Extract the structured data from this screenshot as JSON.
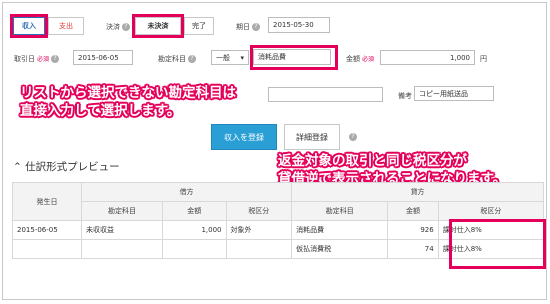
{
  "tabs": {
    "income": "収入",
    "expense": "支出"
  },
  "settlement": {
    "label": "決済",
    "unsettled": "未決済",
    "completed": "完了"
  },
  "due_date": {
    "label": "期日",
    "value": "2015-05-30"
  },
  "transaction_date": {
    "label": "取引日",
    "required": "必須",
    "value": "2015-06-05"
  },
  "account": {
    "label": "勘定科目",
    "select_value": "一般",
    "input_value": "消耗品費"
  },
  "amount": {
    "label": "金額",
    "required": "必須",
    "value": "1,000",
    "unit": "円"
  },
  "note": {
    "label": "備考",
    "value": "コピー用紙送品"
  },
  "callout_left": [
    "リストから選択できない勘定科目は",
    "直接入力して選択します。"
  ],
  "callout_right": [
    "返金対象の取引と同じ税区分が",
    "貸借逆で表示されることになります。"
  ],
  "buttons": {
    "register": "収入を登録",
    "detail": "詳細登録"
  },
  "preview": {
    "title": "仕訳形式プレビュー",
    "group_debit": "借方",
    "group_credit": "貸方",
    "columns": {
      "date": "発生日",
      "account": "勘定科目",
      "amount": "金額",
      "tax": "税区分"
    },
    "rows": [
      {
        "date": "2015-06-05",
        "debit_account": "未収収益",
        "debit_amount": "1,000",
        "debit_tax": "対象外",
        "credit_account": "消耗品費",
        "credit_amount": "926",
        "credit_tax": "課対仕入8%"
      },
      {
        "date": "",
        "debit_account": "",
        "debit_amount": "",
        "debit_tax": "",
        "credit_account": "仮払消費税",
        "credit_amount": "74",
        "credit_tax": "課対仕入8%"
      }
    ]
  },
  "colors": {
    "highlight": "#e4005a",
    "primary_button": "#2a9fd6"
  },
  "icons": [
    "help-icon",
    "chevron-up-icon",
    "dropdown-arrow-icon"
  ]
}
